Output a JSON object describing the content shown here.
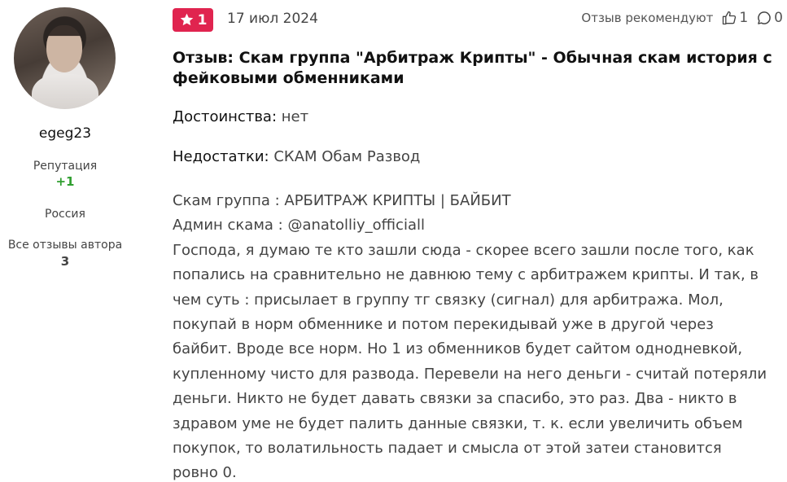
{
  "author": {
    "username": "egeg23",
    "reputation_label": "Репутация",
    "reputation_value": "+1",
    "country": "Россия",
    "all_reviews_label": "Все отзывы автора",
    "all_reviews_count": "3"
  },
  "review": {
    "rating": "1",
    "date": "17 июл 2024",
    "recommend_label": "Отзыв рекомендуют",
    "likes": "1",
    "comments": "0",
    "title": "Отзыв: Скам группа \"Арбитраж Крипты\" - Обычная скам история с фейковыми обменниками",
    "pros_label": "Достоинства:",
    "pros_value": "нет",
    "cons_label": "Недостатки:",
    "cons_value": "СКАМ Обам Развод",
    "body_lines": [
      "Скам группа : АРБИТРАЖ КРИПТЫ | БАЙБИТ",
      "Админ скама : @anatolliy_officiall",
      "Господа, я думаю те кто зашли сюда - скорее всего зашли после того, как",
      "попались на сравнительно не давнюю тему с арбитражем крипты. И так, в",
      "чем суть : присылает в группу тг связку (сигнал) для арбитража. Мол,",
      "покупай в норм обменнике и потом перекидывай уже в другой через",
      "байбит. Вроде все норм. Но 1 из обменников будет сайтом однодневкой,",
      "купленному чисто для развода. Перевели на него деньги - считай потеряли",
      "деньги. Никто не будет давать связки за спасибо, это раз. Два - никто в",
      "здравом уме не будет палить данные связки, т. к. если увеличить объем",
      "покупок, то волатильность падает и смысла от этой затеи становится",
      "ровно 0."
    ]
  },
  "colors": {
    "badge": "#e0244f",
    "reputation": "#2f9e2f"
  },
  "icons": {
    "rating": "star-icon",
    "like": "thumbs-up-icon",
    "comments": "comment-icon"
  }
}
